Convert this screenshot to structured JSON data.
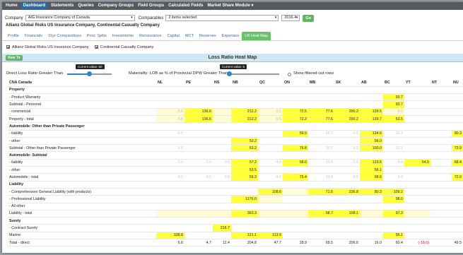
{
  "nav": [
    {
      "label": "Home",
      "active": false
    },
    {
      "label": "Dashboard",
      "active": true
    },
    {
      "label": "Statements",
      "active": false
    },
    {
      "label": "Queries",
      "active": false
    },
    {
      "label": "Company Groups",
      "active": false
    },
    {
      "label": "Field Groups",
      "active": false
    },
    {
      "label": "Calculated Fields",
      "active": false
    },
    {
      "label": "Market Share Module ▾",
      "active": false
    }
  ],
  "controls": {
    "company_label": "Company",
    "company_value": "AIG Insurance Company of Canada",
    "comparables_label": "Comparables",
    "comparables_value": "2 items selected",
    "period_value": "2016.4",
    "go_label": "Go"
  },
  "company_title": "Allianz Global Risks US Insurance Company, Continental Casualty Company",
  "tabs": [
    {
      "label": "Profile",
      "active": false
    },
    {
      "label": "Financials",
      "active": false
    },
    {
      "label": "15yr Comparatives",
      "active": false
    },
    {
      "label": "Prov. Splits",
      "active": false
    },
    {
      "label": "Investments",
      "active": false
    },
    {
      "label": "Reinsurance",
      "active": false
    },
    {
      "label": "Capital",
      "active": false
    },
    {
      "label": "MCT",
      "active": false
    },
    {
      "label": "Reserves",
      "active": false
    },
    {
      "label": "Expenses",
      "active": false
    },
    {
      "label": "LR Heat Map",
      "active": true
    }
  ],
  "checkboxes": [
    {
      "label": "Allianz Global Risks US Insurance Company",
      "checked": true
    },
    {
      "label": "Continental Casualty Company",
      "checked": true
    }
  ],
  "howto_label": "How To",
  "heatmap_title": "Loss Ratio Heat Map",
  "slider1": {
    "label": "Direct Loss Ratio Greater Than",
    "tooltip": "Current value: 50",
    "value": 50,
    "max": 100
  },
  "slider2": {
    "label": "Materiality: LOB as % of Provincial DPW Greater Than",
    "tooltip": "Current value: 5",
    "value": 5,
    "max": 100
  },
  "filter_label": "Show filtered-out rows",
  "columns": [
    "CNA Canada",
    "NL",
    "PE",
    "NS",
    "NB",
    "QC",
    "ON",
    "MB",
    "SK",
    "AB",
    "BC",
    "YT",
    "NT",
    "NU"
  ],
  "rows": [
    {
      "label": "Property",
      "type": "section",
      "cells": [
        "",
        "",
        "",
        "",
        "",
        "",
        "",
        "",
        "",
        "",
        "",
        "",
        ""
      ]
    },
    {
      "label": "- Product Warranty",
      "cells": [
        "",
        "",
        "",
        "",
        "",
        "",
        "",
        "",
        "",
        {
          "v": "93.7",
          "c": "y"
        },
        "",
        "",
        ""
      ]
    },
    {
      "label": "Subtotal - Personal",
      "cells": [
        "",
        "",
        "",
        "",
        "",
        "",
        "",
        "",
        "",
        {
          "v": "93.7",
          "c": "y"
        },
        "",
        "",
        ""
      ]
    },
    {
      "label": "- commercial",
      "cells": [
        {
          "v": "5.6",
          "c": "ly"
        },
        {
          "v": "136.6",
          "c": "y"
        },
        {
          "v": "",
          "c": "ly"
        },
        {
          "v": "212.2",
          "c": "y"
        },
        {
          "v": "9.5",
          "c": "ly"
        },
        {
          "v": "72.5",
          "c": "y"
        },
        {
          "v": "77.6",
          "c": "y"
        },
        {
          "v": "290.2",
          "c": "y"
        },
        {
          "v": "139.5",
          "c": "y"
        },
        {
          "v": "8.0",
          "c": "ly"
        },
        "",
        "",
        ""
      ]
    },
    {
      "label": "Property - total",
      "cells": [
        {
          "v": "5.6",
          "c": "ly"
        },
        {
          "v": "136.6",
          "c": "y"
        },
        {
          "v": "",
          "c": "ly"
        },
        {
          "v": "212.2",
          "c": "y"
        },
        {
          "v": "9.5",
          "c": "ly"
        },
        {
          "v": "72.2",
          "c": "y"
        },
        {
          "v": "77.6",
          "c": "y"
        },
        {
          "v": "290.2",
          "c": "y"
        },
        {
          "v": "139.7",
          "c": "y"
        },
        {
          "v": "53.5",
          "c": "y"
        },
        "",
        "",
        ""
      ]
    },
    {
      "label": "Automobile: Other than Private Passenger",
      "type": "section",
      "cells": [
        "",
        "",
        "",
        "",
        "",
        "",
        "",
        "",
        "",
        "",
        "",
        "",
        ""
      ]
    },
    {
      "label": "- liability",
      "cells": [
        {
          "v": "0.0",
          "c": "faint"
        },
        "",
        "",
        "",
        "",
        {
          "v": "59.9",
          "c": "y"
        },
        {
          "v": "10.7",
          "c": "faint"
        },
        {
          "v": "0.0",
          "c": "faint"
        },
        {
          "v": "134.6",
          "c": "y"
        },
        {
          "v": "12.1",
          "c": "faint"
        },
        "",
        "",
        {
          "v": "90.3",
          "c": "y"
        }
      ]
    },
    {
      "label": "- other",
      "cells": [
        "",
        "",
        "",
        {
          "v": "53.2",
          "c": "y"
        },
        "",
        "",
        "",
        "",
        {
          "v": "56.0",
          "c": "y"
        },
        "",
        "",
        "",
        ""
      ]
    },
    {
      "label": "Subtotal - Other than Private Passenger",
      "cells": [
        {
          "v": "0.0",
          "c": "faint"
        },
        "",
        "",
        {
          "v": "53.2",
          "c": "y"
        },
        "",
        {
          "v": "76.8",
          "c": "y"
        },
        {
          "v": "10.7",
          "c": "faint"
        },
        {
          "v": "0.0",
          "c": "faint"
        },
        {
          "v": "100.0",
          "c": "y"
        },
        {
          "v": "12.1",
          "c": "faint"
        },
        "",
        "",
        {
          "v": "72.9",
          "c": "y"
        }
      ]
    },
    {
      "label": "Automobile: Subtotal",
      "type": "section",
      "cells": [
        "",
        "",
        "",
        "",
        "",
        "",
        "",
        "",
        "",
        "",
        "",
        "",
        ""
      ]
    },
    {
      "label": "- liability",
      "cells": [
        {
          "v": "0.0",
          "c": "faint"
        },
        {
          "v": "0.0",
          "c": "faint"
        },
        {
          "v": "0.0",
          "c": "faint"
        },
        {
          "v": "57.2",
          "c": "y"
        },
        {
          "v": "4.0",
          "c": "faint"
        },
        {
          "v": "58.0",
          "c": "y"
        },
        {
          "v": "10.4",
          "c": "faint"
        },
        {
          "v": "0.0",
          "c": "faint"
        },
        {
          "v": "133.5",
          "c": "y"
        },
        {
          "v": "9.4",
          "c": "faint"
        },
        {
          "v": "54.5",
          "c": "y"
        },
        "",
        {
          "v": "68.4",
          "c": "y"
        }
      ]
    },
    {
      "label": "- other",
      "cells": [
        "",
        "",
        "",
        {
          "v": "53.5",
          "c": "y"
        },
        "",
        "",
        "",
        "",
        {
          "v": "56.1",
          "c": "y"
        },
        "",
        "",
        "",
        ""
      ]
    },
    {
      "label": "Automobile - total",
      "cells": [
        {
          "v": "0.0",
          "c": "faint"
        },
        {
          "v": "0.0",
          "c": "faint"
        },
        {
          "v": "0.0",
          "c": "faint"
        },
        {
          "v": "59.3",
          "c": "y"
        },
        {
          "v": "4.0",
          "c": "faint"
        },
        {
          "v": "75.4",
          "c": "y"
        },
        {
          "v": "10.4",
          "c": "faint"
        },
        {
          "v": "0.0",
          "c": "faint"
        },
        {
          "v": "99.6",
          "c": "y"
        },
        {
          "v": "9.4",
          "c": "faint"
        },
        "",
        "",
        {
          "v": "72.0",
          "c": "y"
        }
      ]
    },
    {
      "label": "Liability",
      "type": "section",
      "cells": [
        "",
        "",
        "",
        "",
        "",
        "",
        "",
        "",
        "",
        "",
        "",
        "",
        ""
      ]
    },
    {
      "label": "- Comprehensive General Liability (with products)",
      "cells": [
        "",
        "",
        "",
        "",
        {
          "v": "108.6",
          "c": "y"
        },
        {
          "v": "",
          "c": "ly"
        },
        {
          "v": "71.6",
          "c": "y"
        },
        {
          "v": "236.8",
          "c": "y"
        },
        {
          "v": "80.3",
          "c": "y"
        },
        {
          "v": "109.2",
          "c": "y"
        },
        "",
        "",
        ""
      ]
    },
    {
      "label": "- Professional Liability",
      "cells": [
        "",
        "",
        "",
        {
          "v": "1176.0",
          "c": "y"
        },
        {
          "v": "",
          "c": "ly"
        },
        "",
        "",
        "",
        "",
        {
          "v": "98.0",
          "c": "y"
        },
        "",
        "",
        ""
      ]
    },
    {
      "label": "- All other",
      "cells": [
        "",
        "",
        "",
        "",
        "",
        "",
        "",
        "",
        "",
        "",
        "",
        "",
        ""
      ]
    },
    {
      "label": "Liability - total",
      "cells": [
        {
          "v": "",
          "c": "ly"
        },
        {
          "v": "",
          "c": "ly"
        },
        {
          "v": "",
          "c": "ly"
        },
        {
          "v": "363.3",
          "c": "y"
        },
        {
          "v": "",
          "c": "ly"
        },
        {
          "v": "",
          "c": "ly"
        },
        {
          "v": "58.7",
          "c": "y"
        },
        {
          "v": "108.1",
          "c": "y"
        },
        {
          "v": "",
          "c": "ly"
        },
        {
          "v": "97.2",
          "c": "y"
        },
        {
          "v": "",
          "c": "ly"
        },
        "",
        ""
      ]
    },
    {
      "label": "Surety",
      "type": "section",
      "cells": [
        "",
        "",
        "",
        "",
        "",
        "",
        "",
        "",
        "",
        "",
        "",
        "",
        ""
      ]
    },
    {
      "label": "- Contract Surety",
      "cells": [
        "",
        "",
        {
          "v": "216.7",
          "c": "y"
        },
        "",
        "",
        "",
        "",
        "",
        "",
        "",
        "",
        "",
        ""
      ]
    },
    {
      "label": "Marine",
      "cells": [
        {
          "v": "338.8",
          "c": "y"
        },
        "",
        "",
        {
          "v": "121.1",
          "c": "y"
        },
        {
          "v": "113.9",
          "c": "y"
        },
        "",
        "",
        "",
        "",
        {
          "v": "56.1",
          "c": "y"
        },
        "",
        "",
        ""
      ]
    },
    {
      "label": "Total - direct",
      "type": "total",
      "cells": [
        "6.6",
        "4.7",
        "12.4",
        "204.8",
        "47.7",
        "28.9",
        "69.5",
        "206.6",
        "16.0",
        "60.4",
        {
          "v": "(-18.6)",
          "c": "neg"
        },
        "",
        "49.5"
      ]
    }
  ]
}
